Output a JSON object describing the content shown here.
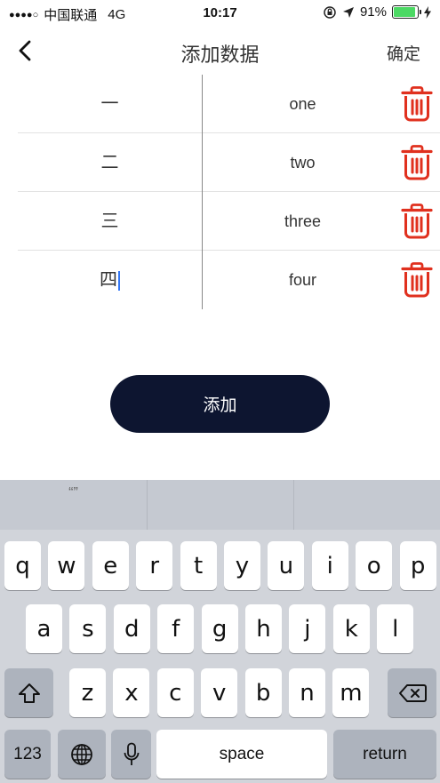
{
  "status_bar": {
    "signal_dots": "●●●●○",
    "carrier": "中国联通",
    "network": "4G",
    "time": "10:17",
    "battery_percent": "91%",
    "battery_level": 0.91
  },
  "nav": {
    "title": "添加数据",
    "confirm_label": "确定"
  },
  "rows": [
    {
      "left": "一",
      "right": "one"
    },
    {
      "left": "二",
      "right": "two"
    },
    {
      "left": "三",
      "right": "three"
    },
    {
      "left": "四",
      "right": "four"
    }
  ],
  "add_button_label": "添加",
  "keyboard": {
    "suggestions": [
      "“”",
      "",
      ""
    ],
    "row1": [
      "q",
      "w",
      "e",
      "r",
      "t",
      "y",
      "u",
      "i",
      "o",
      "p"
    ],
    "row2": [
      "a",
      "s",
      "d",
      "f",
      "g",
      "h",
      "j",
      "k",
      "l"
    ],
    "row3": [
      "z",
      "x",
      "c",
      "v",
      "b",
      "n",
      "m"
    ],
    "numbers_label": "123",
    "space_label": "space",
    "return_label": "return"
  },
  "colors": {
    "accent_dark": "#0d1530",
    "trash_red": "#e0301e",
    "battery_green": "#4cd964"
  }
}
